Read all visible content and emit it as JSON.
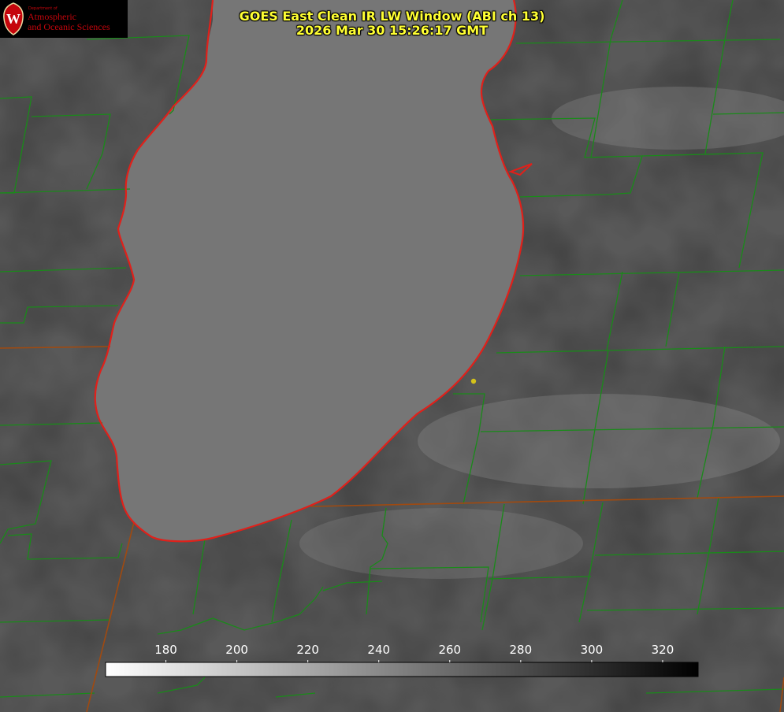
{
  "logo": {
    "department": "Department of",
    "line1": "Atmospheric",
    "line2": "and Oceanic Sciences",
    "seal_letter": "W",
    "colors": {
      "seal": "#c5050c",
      "text": "#c5050c"
    }
  },
  "title": {
    "line1": "GOES East Clean IR LW Window (ABI ch 13)",
    "line2": "2026 Mar 30 15:26:17 GMT",
    "color": "#ffff33"
  },
  "colorbar": {
    "ticks": [
      180,
      200,
      220,
      240,
      260,
      280,
      300,
      320
    ],
    "range": [
      163,
      330
    ],
    "gradient": [
      "#ffffff",
      "#000000"
    ]
  },
  "colors": {
    "county_lines": "#1a8a1a",
    "state_lines": "#a04a10",
    "coastline": "#e0201a",
    "marker": "#d4c21a",
    "lake": "#767676",
    "land": "#5b5b5b"
  }
}
